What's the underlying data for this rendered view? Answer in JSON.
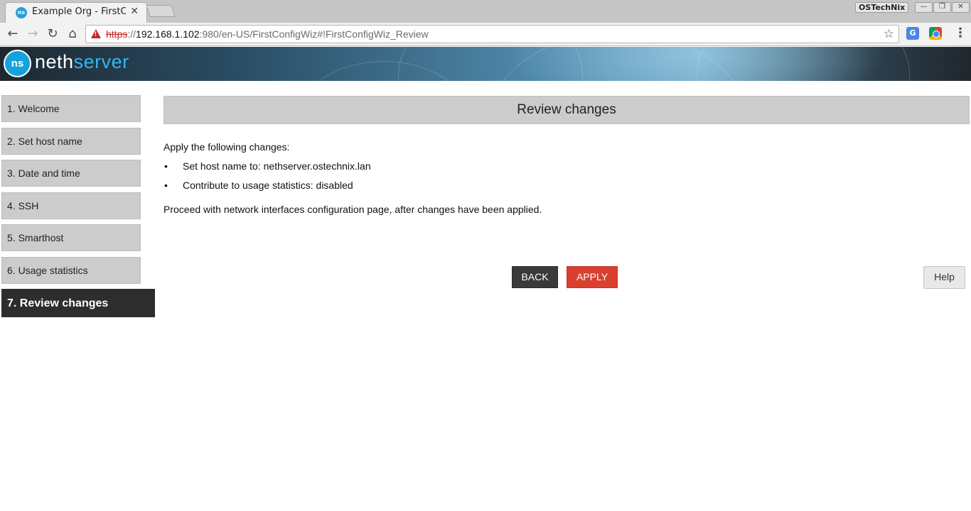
{
  "browser": {
    "tab_title": "Example Org - FirstC",
    "tab_close": "✕",
    "profile_name": "OSTechNix",
    "url": {
      "scheme": "https",
      "separator": "://",
      "host": "192.168.1.102",
      "rest": ":980/en-US/FirstConfigWiz#!FirstConfigWiz_Review"
    },
    "icons": {
      "back": "←",
      "forward": "→",
      "reload": "↻",
      "home": "⌂",
      "star": "☆",
      "menu": "⋮",
      "translate": "G",
      "minimize": "—",
      "maximize": "❐",
      "close": "✕"
    }
  },
  "banner": {
    "logo_mark": "ns",
    "logo_text_a": "neth",
    "logo_text_b": "server"
  },
  "steps": [
    {
      "label": "1. Welcome"
    },
    {
      "label": "2. Set host name"
    },
    {
      "label": "3. Date and time"
    },
    {
      "label": "4. SSH"
    },
    {
      "label": "5. Smarthost"
    },
    {
      "label": "6. Usage statistics"
    },
    {
      "label": "7. Review changes"
    }
  ],
  "main": {
    "title": "Review changes",
    "intro": "Apply the following changes:",
    "bullet_symbol": "•",
    "changes": [
      "Set host name to: nethserver.ostechnix.lan",
      "Contribute to usage statistics: disabled"
    ],
    "outro": "Proceed with network interfaces configuration page, after changes have been applied.",
    "back_label": "BACK",
    "apply_label": "APPLY",
    "help_label": "Help"
  },
  "colors": {
    "active_step": "#2d2d2d",
    "apply_button": "#d9402f",
    "back_button": "#3a3a3a",
    "brand_blue": "#15a2dc"
  }
}
